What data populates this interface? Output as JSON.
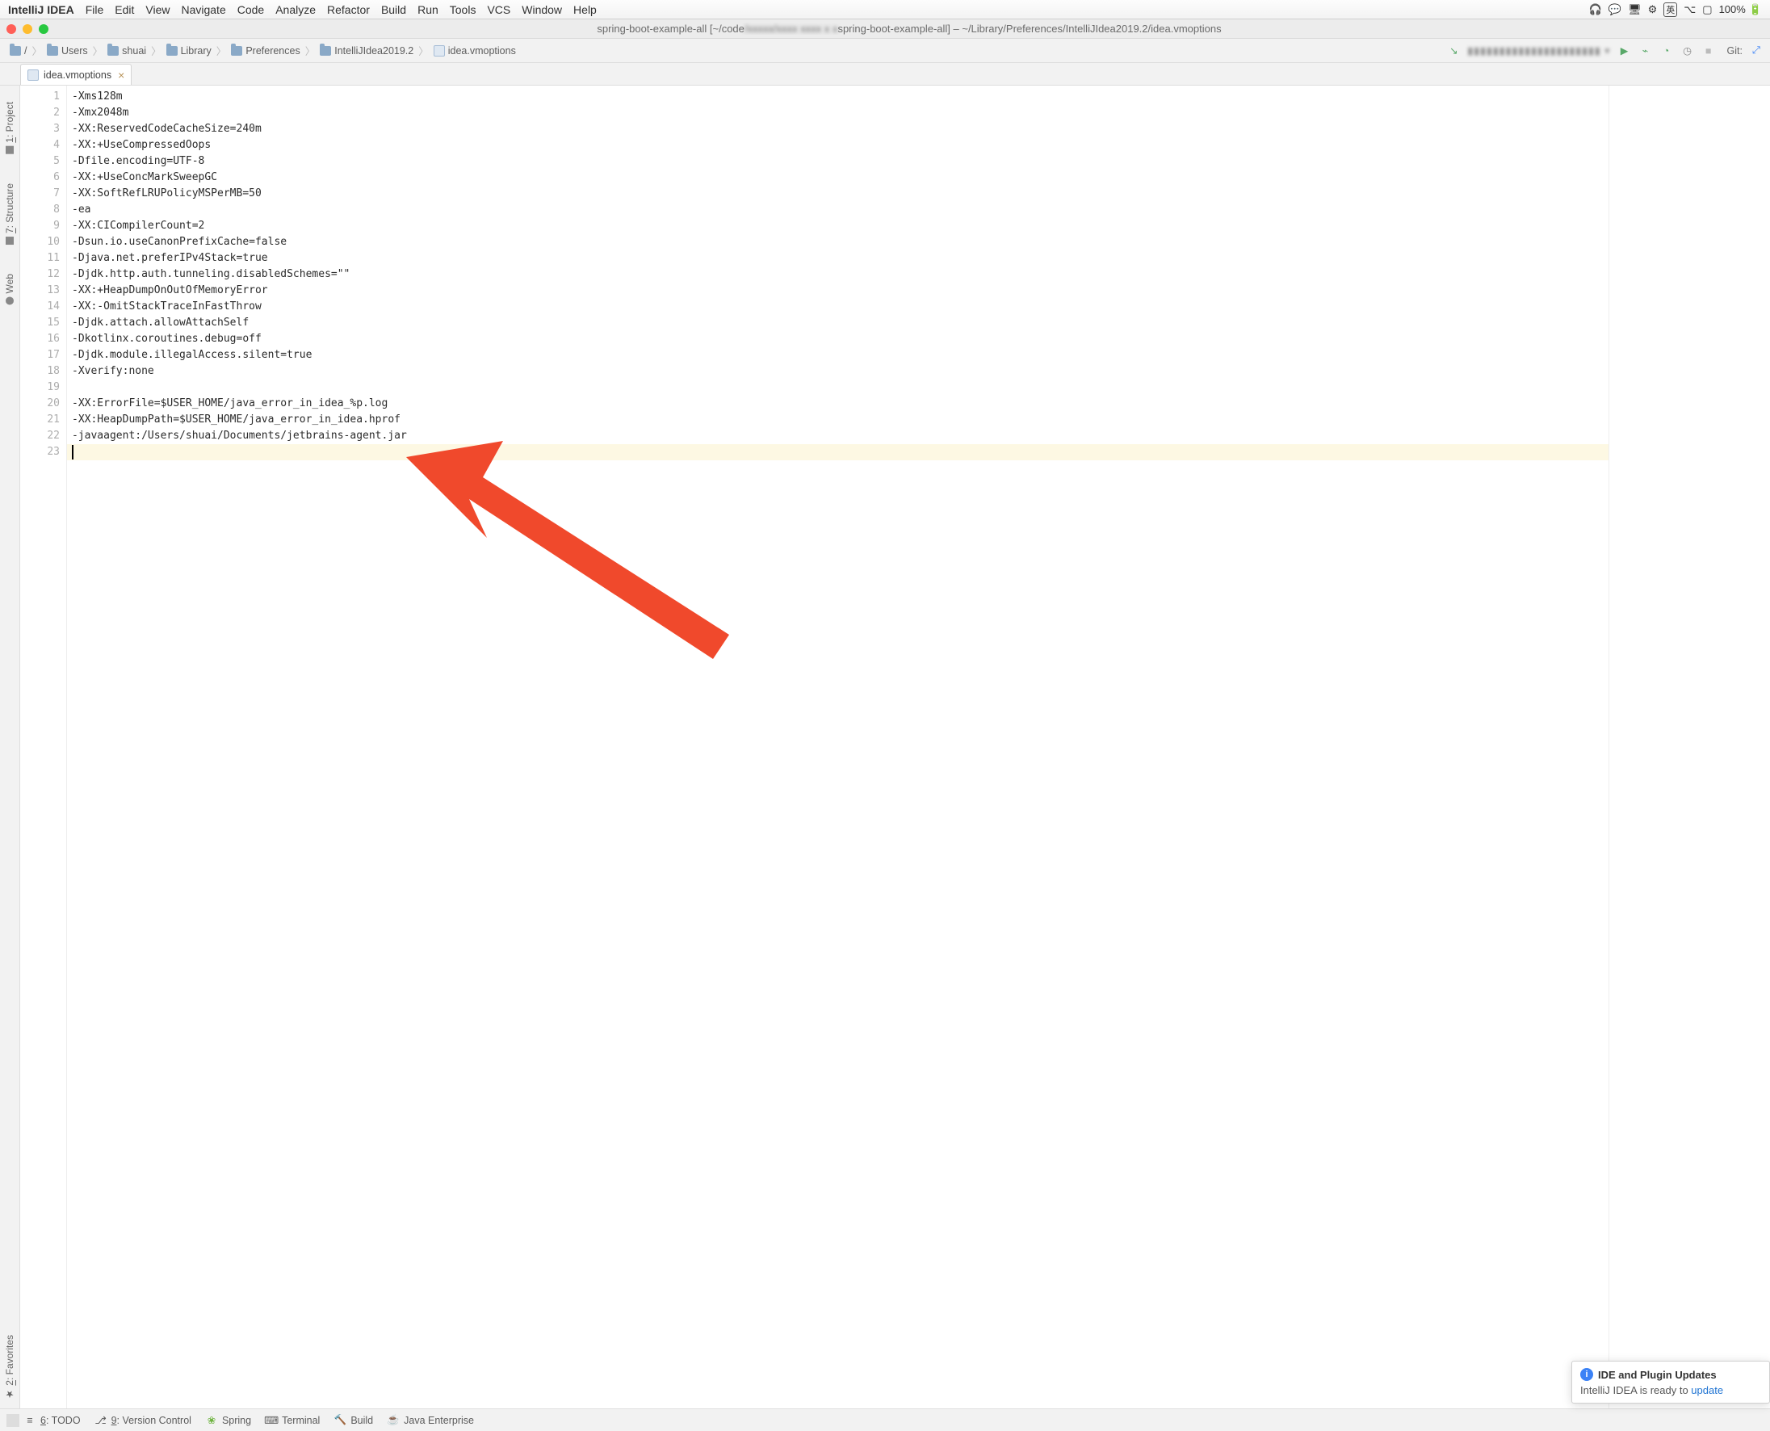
{
  "menubar": {
    "app": "IntelliJ IDEA",
    "items": [
      "File",
      "Edit",
      "View",
      "Navigate",
      "Code",
      "Analyze",
      "Refactor",
      "Build",
      "Run",
      "Tools",
      "VCS",
      "Window",
      "Help"
    ],
    "battery": "100%"
  },
  "window": {
    "title_left": "spring-boot-example-all [~/code",
    "title_right": "spring-boot-example-all] – ~/Library/Preferences/IntelliJIdea2019.2/idea.vmoptions"
  },
  "breadcrumbs": [
    "/",
    "Users",
    "shuai",
    "Library",
    "Preferences",
    "IntelliJIdea2019.2",
    "idea.vmoptions"
  ],
  "navbar": {
    "git_label": "Git:"
  },
  "tab": {
    "filename": "idea.vmoptions"
  },
  "left_tools": {
    "project": "1: Project",
    "structure": "7: Structure",
    "web": "Web",
    "favorites": "2: Favorites"
  },
  "code": {
    "lines": [
      "-Xms128m",
      "-Xmx2048m",
      "-XX:ReservedCodeCacheSize=240m",
      "-XX:+UseCompressedOops",
      "-Dfile.encoding=UTF-8",
      "-XX:+UseConcMarkSweepGC",
      "-XX:SoftRefLRUPolicyMSPerMB=50",
      "-ea",
      "-XX:CICompilerCount=2",
      "-Dsun.io.useCanonPrefixCache=false",
      "-Djava.net.preferIPv4Stack=true",
      "-Djdk.http.auth.tunneling.disabledSchemes=\"\"",
      "-XX:+HeapDumpOnOutOfMemoryError",
      "-XX:-OmitStackTraceInFastThrow",
      "-Djdk.attach.allowAttachSelf",
      "-Dkotlinx.coroutines.debug=off",
      "-Djdk.module.illegalAccess.silent=true",
      "-Xverify:none",
      "",
      "-XX:ErrorFile=$USER_HOME/java_error_in_idea_%p.log",
      "-XX:HeapDumpPath=$USER_HOME/java_error_in_idea.hprof",
      "-javaagent:/Users/shuai/Documents/jetbrains-agent.jar",
      ""
    ]
  },
  "bottom_tools": {
    "todo": "6: TODO",
    "vcs": "9: Version Control",
    "spring": "Spring",
    "terminal": "Terminal",
    "build": "Build",
    "jee": "Java Enterprise"
  },
  "popup": {
    "title": "IDE and Plugin Updates",
    "body_prefix": "IntelliJ IDEA is ready to ",
    "body_link": "update"
  }
}
